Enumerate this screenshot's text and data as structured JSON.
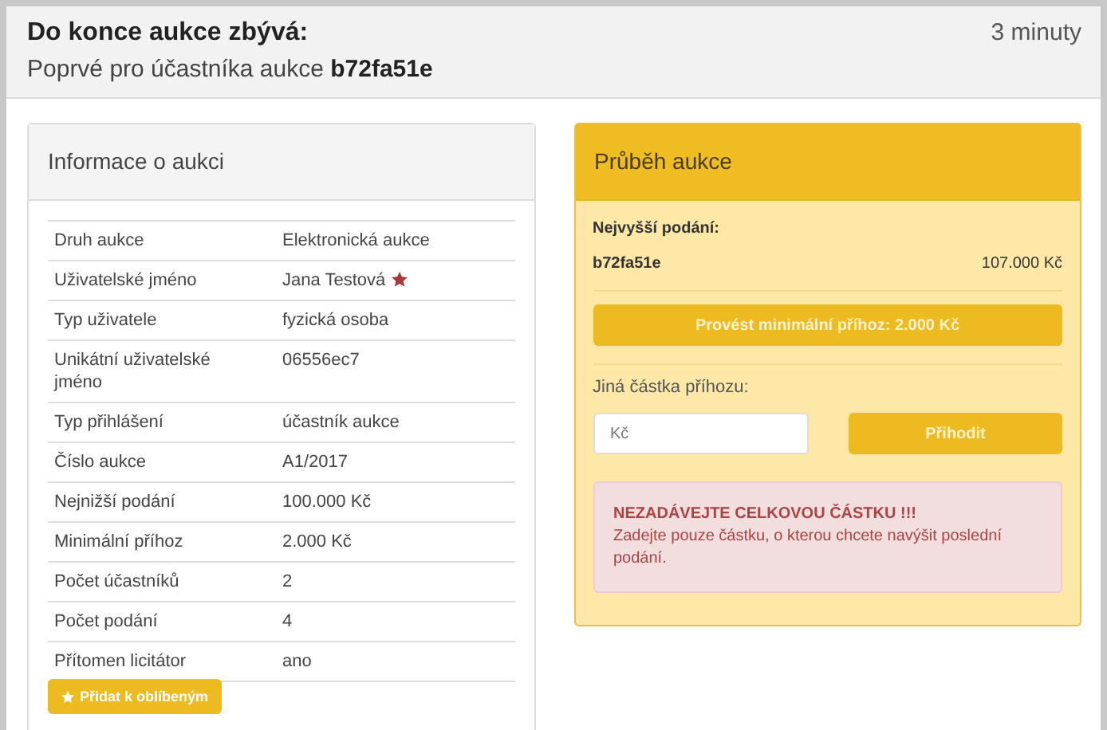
{
  "header": {
    "title": "Do konce aukce zbývá:",
    "subtitle": "Poprvé pro účastníka aukce **b72fa51e**",
    "time_left": "3 minuty"
  },
  "info_panel": {
    "title": "Informace o aukci",
    "rows": [
      {
        "label": "Druh aukce",
        "value": "Elektronická aukce",
        "starred": false
      },
      {
        "label": "Uživatelské jméno",
        "value": "Jana Testová",
        "starred": true
      },
      {
        "label": "Typ uživatele",
        "value": "fyzická osoba",
        "starred": false
      },
      {
        "label": "Unikátní uživatelské jméno",
        "value": "06556ec7",
        "starred": false
      },
      {
        "label": "Typ přihlášení",
        "value": "účastník aukce",
        "starred": false
      },
      {
        "label": "Číslo aukce",
        "value": "A1/2017",
        "starred": false
      },
      {
        "label": "Nejnižší podání",
        "value": "100.000 Kč",
        "starred": false
      },
      {
        "label": "Minimální příhoz",
        "value": "2.000 Kč",
        "starred": false
      },
      {
        "label": "Počet účastníků",
        "value": "2",
        "starred": false
      },
      {
        "label": "Počet podání",
        "value": "4",
        "starred": false
      },
      {
        "label": "Přítomen licitátor",
        "value": "ano",
        "starred": false
      }
    ],
    "favorite_button": "Přidat k oblíbeným"
  },
  "progress_panel": {
    "title": "Průběh aukce",
    "highest_bid_label": "Nejvyšší podání:",
    "highest_bidder": "b72fa51e",
    "highest_bid": "107.000 Kč",
    "min_bid_button": "Provést minimální příhoz: 2.000 Kč",
    "other_amount_label": "Jiná částka příhozu:",
    "amount_field": {
      "placeholder": "Kč"
    },
    "bid_button": "Přihodit",
    "warning": {
      "title": "NEZADÁVEJTE CELKOVOU ČÁSTKU !!!",
      "text": "Zadejte pouze částku, o kterou chcete navýšit poslední podání."
    }
  }
}
